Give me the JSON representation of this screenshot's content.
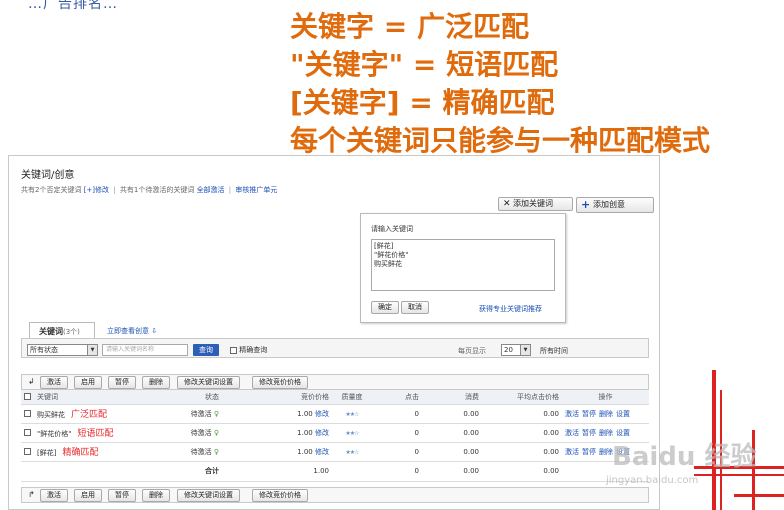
{
  "headline": {
    "top_fragment": "…广告排名…",
    "lines": [
      "关键字 = 广泛匹配",
      "\"关键字\" = 短语匹配",
      "[关键字] = 精确匹配",
      "每个关键词只能参与一种匹配模式"
    ]
  },
  "panel": {
    "title": "关键词/创意",
    "info": {
      "total_prefix": "共有2个否定关键词",
      "modify": "[+]修改",
      "pending": "共有1个待激活的关键词",
      "activate_all": "全部激活",
      "review": "审核推广单元"
    },
    "add_keyword_button": "添加关键词",
    "add_idea_button": "添加创意",
    "popup": {
      "label": "请输入关键词",
      "textarea_value": "[鲜花]\n\"鲜花价格\"\n购买鲜花",
      "ok": "确定",
      "cancel": "取消",
      "pro_link": "获得专业关键词推荐"
    },
    "tabs": {
      "active_label": "关键词",
      "active_count": "(3个)",
      "link": "立即查看创意 ⇩"
    },
    "filter": {
      "status_value": "所有状态",
      "search_placeholder": "请输入关键词名称",
      "search_button": "查询",
      "exact_label": "精确查询",
      "perpage_label": "每页显示",
      "perpage_value": "20",
      "time_label": "所有时间"
    },
    "actions": [
      "激活",
      "启用",
      "暂停",
      "删除",
      "修改关键词设置",
      "修改竞价价格"
    ],
    "columns": [
      "关键词",
      "状态",
      "竞价价格",
      "质量度",
      "点击",
      "消费",
      "平均点击价格",
      "操作"
    ],
    "rows": [
      {
        "keyword": "购买鲜花",
        "match": "广泛匹配",
        "status": "待激活",
        "bid": "1.00",
        "bid_link": "修改",
        "clicks": "0",
        "cost": "0.00",
        "avg": "0.00"
      },
      {
        "keyword": "\"鲜花价格\"",
        "match": "短语匹配",
        "status": "待激活",
        "bid": "1.00",
        "bid_link": "修改",
        "clicks": "0",
        "cost": "0.00",
        "avg": "0.00"
      },
      {
        "keyword": "[鲜花]",
        "match": "精确匹配",
        "status": "待激活",
        "bid": "1.00",
        "bid_link": "修改",
        "clicks": "0",
        "cost": "0.00",
        "avg": "0.00"
      }
    ],
    "row_ops": [
      "激活",
      "暂停",
      "删除",
      "设置"
    ],
    "total": {
      "label": "合计",
      "bid": "1.00",
      "clicks": "0",
      "cost": "0.00",
      "avg": "0.00"
    }
  },
  "watermark": {
    "main": "Baidu 经验",
    "sub": "jingyan.baidu.com"
  },
  "colors": {
    "headline": "#e06b0d",
    "match_type": "#e8262b",
    "link": "#1a4fb5",
    "search_button": "#2e5fb7",
    "decoration": "#dd2222"
  }
}
